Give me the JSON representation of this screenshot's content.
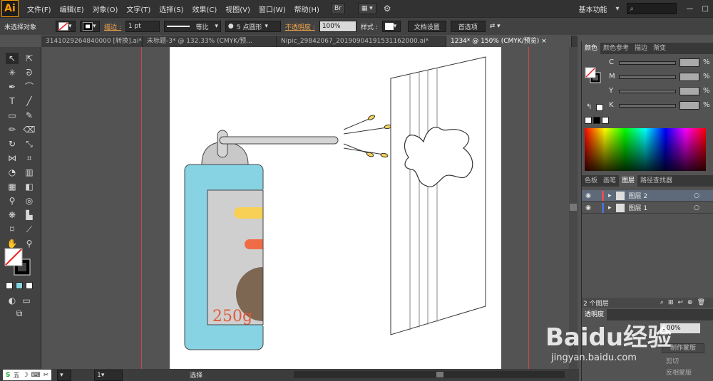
{
  "app": {
    "logo": "Ai"
  },
  "menu": [
    "文件(F)",
    "编辑(E)",
    "对象(O)",
    "文字(T)",
    "选择(S)",
    "效果(C)",
    "视图(V)",
    "窗口(W)",
    "帮助(H)"
  ],
  "menubar_right": {
    "br_label": "Br",
    "workspace": "基本功能",
    "search_placeholder": ""
  },
  "control": {
    "selection_label": "未选择对象",
    "stroke_label": "描边 :",
    "stroke_weight": "1 pt",
    "profile_label": "等比",
    "brush_label": "5 点圆形",
    "opacity_label": "不透明度 :",
    "opacity_value": "100%",
    "style_label": "样式 :",
    "doc_setup": "文档设置",
    "preferences": "首选项"
  },
  "tabs": [
    {
      "label": "3141029264840000 [转换].ai*"
    },
    {
      "label": "未标题-3* @ 132.33% (CMYK/预..."
    },
    {
      "label": "Nipic_29842067_20190904191531162000.ai*"
    },
    {
      "label": "1234* @ 150% (CMYK/预览)"
    }
  ],
  "artwork": {
    "can_label": "250g"
  },
  "color_panel": {
    "tabs": [
      "颜色",
      "颜色参考",
      "描边",
      "渐变"
    ],
    "channels": [
      "C",
      "M",
      "Y",
      "K"
    ],
    "percent": "%"
  },
  "layers_panel": {
    "tabs": [
      "色板",
      "画笔",
      "图层",
      "路径查找器"
    ],
    "layers": [
      {
        "name": "图层 2",
        "color": "#e05050"
      },
      {
        "name": "图层 1",
        "color": "#4a6fd6"
      }
    ],
    "footer": "2 个图层"
  },
  "transparency_panel": {
    "title": "透明度",
    "opacity": "100%",
    "make_mask": "制作蒙版",
    "clip": "剪切",
    "invert": "反相蒙版"
  },
  "status": {
    "zoom": "150%",
    "page": "1",
    "tool": "选择"
  },
  "watermark": {
    "text": "Baidu经验",
    "url": "jingyan.baidu.com"
  },
  "ime": {
    "text": "五"
  },
  "colors": {
    "can_body": "#87d3e3",
    "label_panel": "#cfcfcf",
    "bar_yellow": "#f7d055",
    "bar_orange": "#ef6c47",
    "circle_brown": "#7d6652",
    "text_250g": "#e05a3a"
  }
}
